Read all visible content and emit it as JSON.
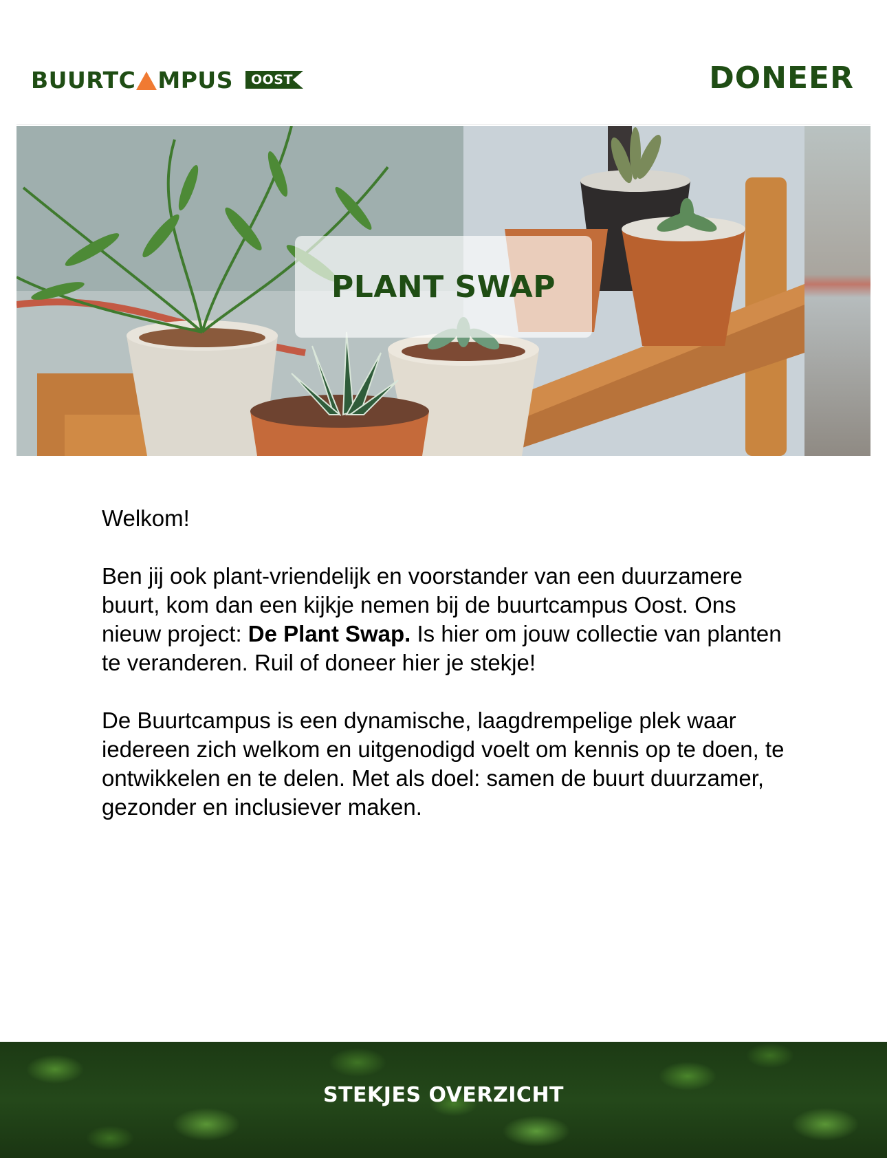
{
  "header": {
    "logo_text_before": "BUURTC",
    "logo_text_after": "MPUS",
    "logo_tag": "OOST",
    "donate_label": "DONEER"
  },
  "hero": {
    "title": "PLANT SWAP"
  },
  "intro": {
    "greeting": "Welkom!",
    "paragraph1_part1": "Ben jij ook plant-vriendelijk en voorstander van een duurzamere buurt, kom dan een kijkje nemen bij de buurtcampus Oost. Ons nieuw project: ",
    "paragraph1_bold": "De Plant Swap.",
    "paragraph1_part2": " Is hier om jouw collectie van planten te veranderen. Ruil of doneer hier je stekje!",
    "paragraph2": "De Buurtcampus is een dynamische, laagdrempelige plek waar iedereen zich welkom en uitgenodigd voelt om kennis op te doen, te ontwikkelen en te delen. Met als doel: samen de buurt duurzamer, gezonder en inclusiever maken."
  },
  "footer": {
    "overview_label": "STEKJES OVERZICHT"
  },
  "colors": {
    "brand_green": "#1f4d14",
    "accent_orange": "#f07a32"
  }
}
